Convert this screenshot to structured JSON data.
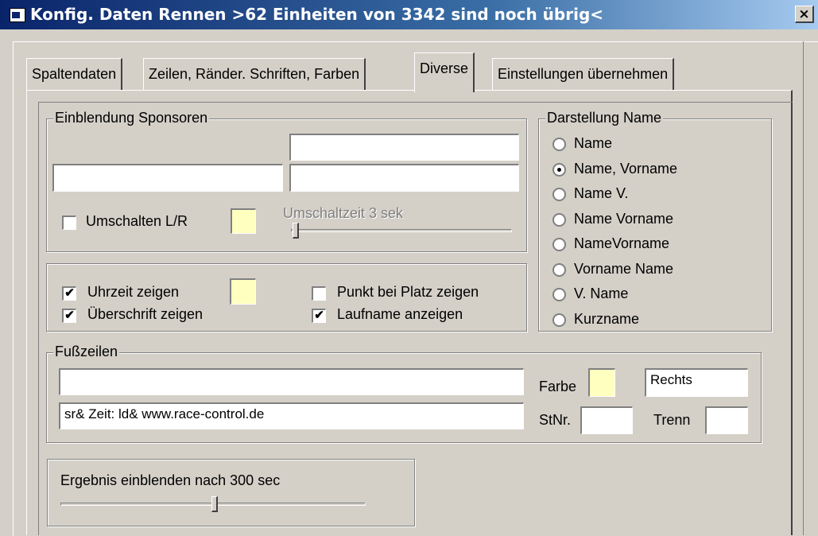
{
  "window": {
    "title": "Konfig. Daten Rennen >62 Einheiten von 3342 sind noch übrig<",
    "close": "×"
  },
  "tabs": [
    {
      "label": "Spaltendaten",
      "active": false
    },
    {
      "label": "Zeilen, Ränder. Schriften, Farben",
      "active": false
    },
    {
      "label": "Diverse",
      "active": true
    },
    {
      "label": "Einstellungen übernehmen",
      "active": false
    }
  ],
  "sponsors": {
    "legend": "Einblendung Sponsoren",
    "field_top_right": "",
    "field_left": "",
    "field_right": "",
    "switch_lr_label": "Umschalten L/R",
    "switch_lr_checked": false,
    "switch_time_label": "Umschaltzeit 3 sek",
    "switch_time_level": 0.0
  },
  "display": {
    "show_time_label": "Uhrzeit zeigen",
    "show_time_checked": true,
    "show_heading_label": "Überschrift zeigen",
    "show_heading_checked": true,
    "dot_rank_label": "Punkt bei Platz zeigen",
    "dot_rank_checked": false,
    "run_name_label": "Laufname anzeigen",
    "run_name_checked": true
  },
  "name_display": {
    "legend": "Darstellung Name",
    "options": [
      "Name",
      "Name, Vorname",
      "Name V.",
      "Name Vorname",
      "NameVorname",
      "Vorname Name",
      "V. Name",
      "Kurzname"
    ],
    "selected": "Name, Vorname"
  },
  "footer": {
    "legend": "Fußzeilen",
    "line1": "",
    "line2": "sr& Zeit: ld&    www.race-control.de",
    "color_label": "Farbe",
    "align_value": "Rechts",
    "stnr_label": "StNr.",
    "stnr_value": "",
    "trenn_label": "Trenn",
    "trenn_value": ""
  },
  "result": {
    "label": "Ergebnis einblenden nach 300 sec",
    "level": 0.5
  },
  "colors": {
    "title_start": "#0a246a",
    "title_end": "#a6caf0",
    "swatch": "#ffffc0",
    "face": "#d4d0c8"
  }
}
